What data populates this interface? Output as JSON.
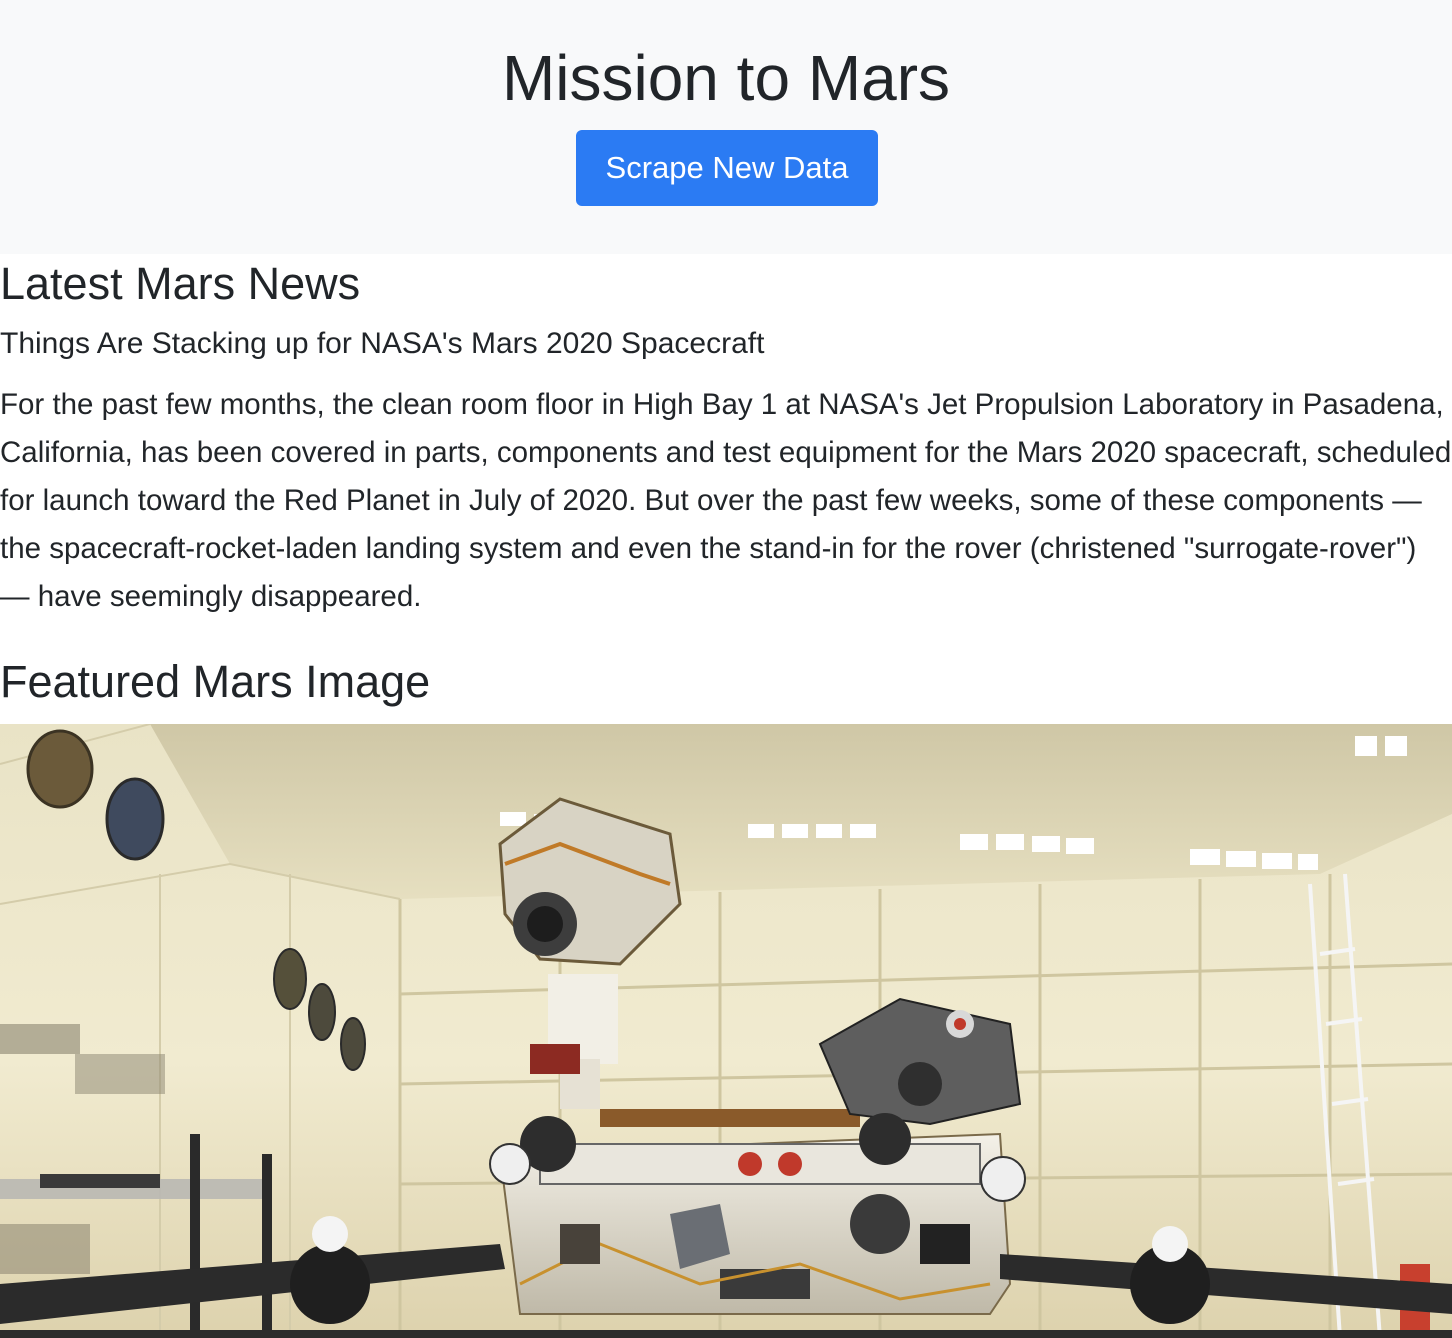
{
  "header": {
    "title": "Mission to Mars",
    "scrape_button_label": "Scrape New Data"
  },
  "news": {
    "section_heading": "Latest Mars News",
    "title": "Things Are Stacking up for NASA's Mars 2020 Spacecraft",
    "paragraph": "For the past few months, the clean room floor in High Bay 1 at NASA's Jet Propulsion Laboratory in Pasadena, California, has been covered in parts, components and test equipment for the Mars 2020 spacecraft, scheduled for launch toward the Red Planet in July of 2020. But over the past few weeks, some of these components — the spacecraft-rocket-laden landing system and even the stand-in for the rover (christened \"surrogate-rover\") — have seemingly disappeared."
  },
  "featured_image": {
    "section_heading": "Featured Mars Image"
  },
  "colors": {
    "jumbotron_bg": "#f8f9fa",
    "primary_button": "#2b7bf3",
    "text": "#212529"
  }
}
